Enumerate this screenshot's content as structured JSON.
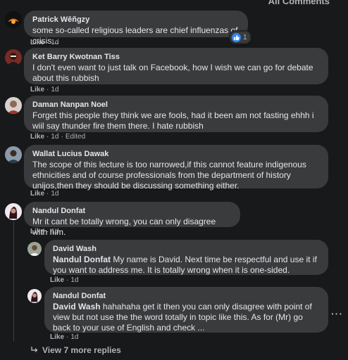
{
  "header": {
    "all_comments_label": "All Comments"
  },
  "comments": [
    {
      "author": "Patrick Wěñgzy",
      "text": "some so-called religious leaders are chief influenzas of crisis...",
      "like_label": "Like",
      "time": "1d",
      "reaction_count": "1"
    },
    {
      "author": "Ket Barry Kwotnan Tiss",
      "text": "I don't even want to just talk on Facebook, how I wish we can go for debate about this rubbish",
      "like_label": "Like",
      "time": "1d"
    },
    {
      "author": "Daman Nanpan Noel",
      "text": "Forget this people they think we are fools, had it been am not fasting ehhh i wiil say thunder fire them there. I hate rubbish",
      "like_label": "Like",
      "time": "1d",
      "edited": "Edited"
    },
    {
      "author": "Wallat Lucius Dawak",
      "text": "The scope of this lecture is too narrowed,if this cannot feature indigenous ethnicities and of course professionals from the department of history unijos,then they should be discussing something either.",
      "like_label": "Like",
      "time": "1d"
    },
    {
      "author": "Nandul Donfat",
      "text": "Mr it cant be totally wrong, you can only disagree with him.",
      "like_label": "Like",
      "time": "1d"
    }
  ],
  "replies": [
    {
      "author": "David Wash",
      "mention": "Nandul Donfat",
      "text": " My name is David. Next time be respectful and use it if you want to address me. It is totally wrong when it is one-sided.",
      "like_label": "Like",
      "time": "1d"
    },
    {
      "author": "Nandul Donfat",
      "mention": "David Wash",
      "text": " hahahaha get it then you can only disagree with point of view but not use the the word totally in topic like this. As for (Mr) go back to your use of English and check ...",
      "like_label": "Like",
      "time": "1d"
    }
  ],
  "view_more_replies_label": "View 7 more replies",
  "icons": {
    "reaction": "like-reaction-icon",
    "more": "more-options-icon",
    "reply_arrow": "reply-arrow-icon"
  },
  "colors": {
    "background": "#18191a",
    "bubble": "#3a3b3c",
    "text": "#e4e6eb",
    "secondary_text": "#b0b3b8",
    "like_blue": "#2d88ff"
  }
}
